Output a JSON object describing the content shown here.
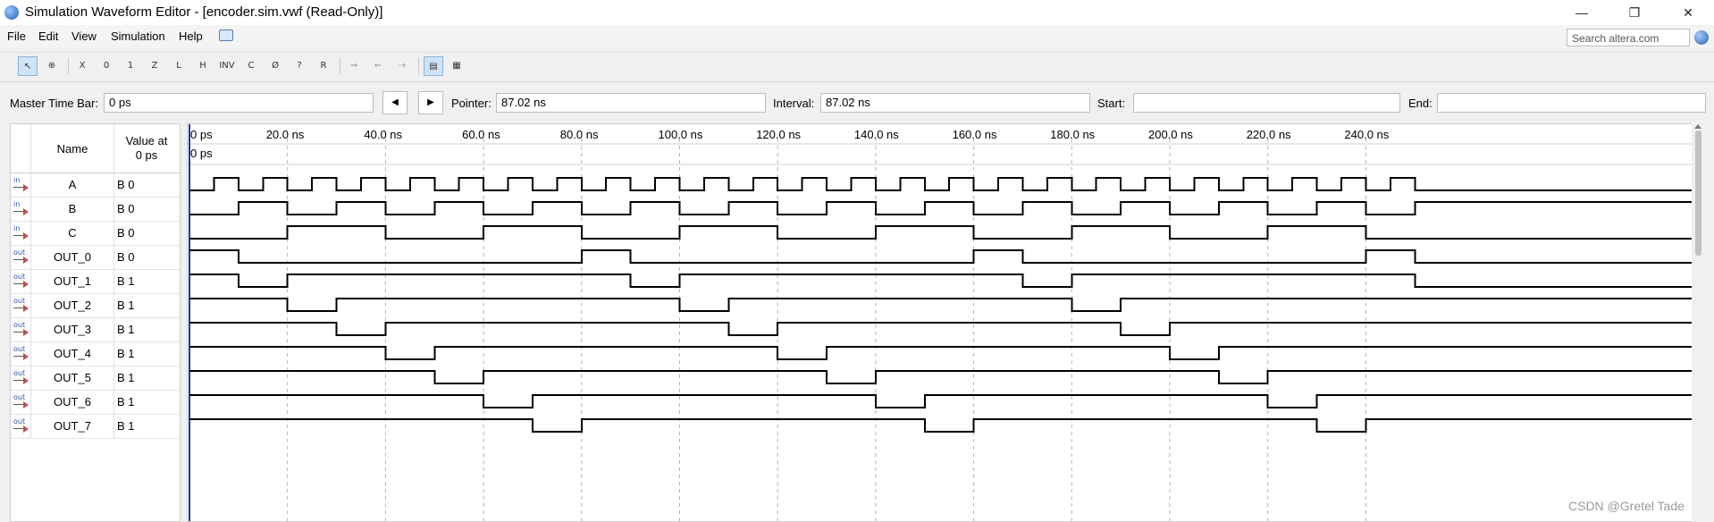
{
  "window": {
    "title": "Simulation Waveform Editor - [encoder.sim.vwf (Read-Only)]",
    "controls": [
      "—",
      "❐",
      "✕"
    ]
  },
  "menu": {
    "items": [
      "File",
      "Edit",
      "View",
      "Simulation",
      "Help"
    ],
    "search_placeholder": "Search altera.com"
  },
  "toolbar": {
    "buttons": [
      {
        "icon": "pointer-tool-icon",
        "glyph": "↖"
      },
      {
        "icon": "zoom-tool-icon",
        "glyph": "⊕"
      },
      {
        "icon": "forcing-unknown-icon",
        "glyph": "X"
      },
      {
        "icon": "forcing-low-icon",
        "glyph": "0"
      },
      {
        "icon": "forcing-high-icon",
        "glyph": "1"
      },
      {
        "icon": "high-impedance-icon",
        "glyph": "Z"
      },
      {
        "icon": "weak-low-icon",
        "glyph": "L"
      },
      {
        "icon": "weak-high-icon",
        "glyph": "H"
      },
      {
        "icon": "invert-icon",
        "glyph": "INV"
      },
      {
        "icon": "count-value-icon",
        "glyph": "C"
      },
      {
        "icon": "clock-value-icon",
        "glyph": "Ø"
      },
      {
        "icon": "arbitrary-value-icon",
        "glyph": "?"
      },
      {
        "icon": "random-value-icon",
        "glyph": "R"
      },
      {
        "icon": "snap-to-grid-icon",
        "glyph": "⇝"
      },
      {
        "icon": "snap-edges-icon",
        "glyph": "⇜"
      },
      {
        "icon": "sort-icon",
        "glyph": "⇢"
      },
      {
        "icon": "waveform-view-icon",
        "glyph": "▤"
      },
      {
        "icon": "grid-settings-icon",
        "glyph": "▦"
      }
    ]
  },
  "timebar": {
    "master_label": "Master Time Bar:",
    "master_value": "0 ps",
    "prev_label": "◀",
    "next_label": "▶",
    "pointer_label": "Pointer:",
    "pointer_value": "87.02 ns",
    "interval_label": "Interval:",
    "interval_value": "87.02 ns",
    "start_label": "Start:",
    "start_value": "",
    "end_label": "End:",
    "end_value": ""
  },
  "table_header": {
    "name": "Name",
    "value_line1": "Value at",
    "value_line2": "0 ps"
  },
  "time_axis": {
    "labels": [
      "0 ps",
      "20.0 ns",
      "40.0 ns",
      "60.0 ns",
      "80.0 ns",
      "100.0 ns",
      "120.0 ns",
      "140.0 ns",
      "160.0 ns",
      "180.0 ns",
      "200.0 ns",
      "220.0 ns",
      "240.0 ns"
    ],
    "marker_label": "0 ps",
    "step_ns": 20,
    "max_ns": 250
  },
  "signals": [
    {
      "dir": "in",
      "name": "A",
      "value": "B 0",
      "period_ns": 10,
      "phase_ns": 5,
      "invert": false
    },
    {
      "dir": "in",
      "name": "B",
      "value": "B 0",
      "period_ns": 20,
      "phase_ns": 10,
      "invert": false
    },
    {
      "dir": "in",
      "name": "C",
      "value": "B 0",
      "period_ns": 40,
      "phase_ns": 20,
      "invert": false
    },
    {
      "dir": "out",
      "name": "OUT_0",
      "value": "B 0",
      "code": 0,
      "invert": false
    },
    {
      "dir": "out",
      "name": "OUT_1",
      "value": "B 1",
      "code": 1,
      "invert": true
    },
    {
      "dir": "out",
      "name": "OUT_2",
      "value": "B 1",
      "code": 2,
      "invert": true
    },
    {
      "dir": "out",
      "name": "OUT_3",
      "value": "B 1",
      "code": 3,
      "invert": true
    },
    {
      "dir": "out",
      "name": "OUT_4",
      "value": "B 1",
      "code": 4,
      "invert": true
    },
    {
      "dir": "out",
      "name": "OUT_5",
      "value": "B 1",
      "code": 5,
      "invert": true
    },
    {
      "dir": "out",
      "name": "OUT_6",
      "value": "B 1",
      "code": 6,
      "invert": true
    },
    {
      "dir": "out",
      "name": "OUT_7",
      "value": "B 1",
      "code": 7,
      "invert": true
    }
  ],
  "watermark": "CSDN @Gretel Tade"
}
